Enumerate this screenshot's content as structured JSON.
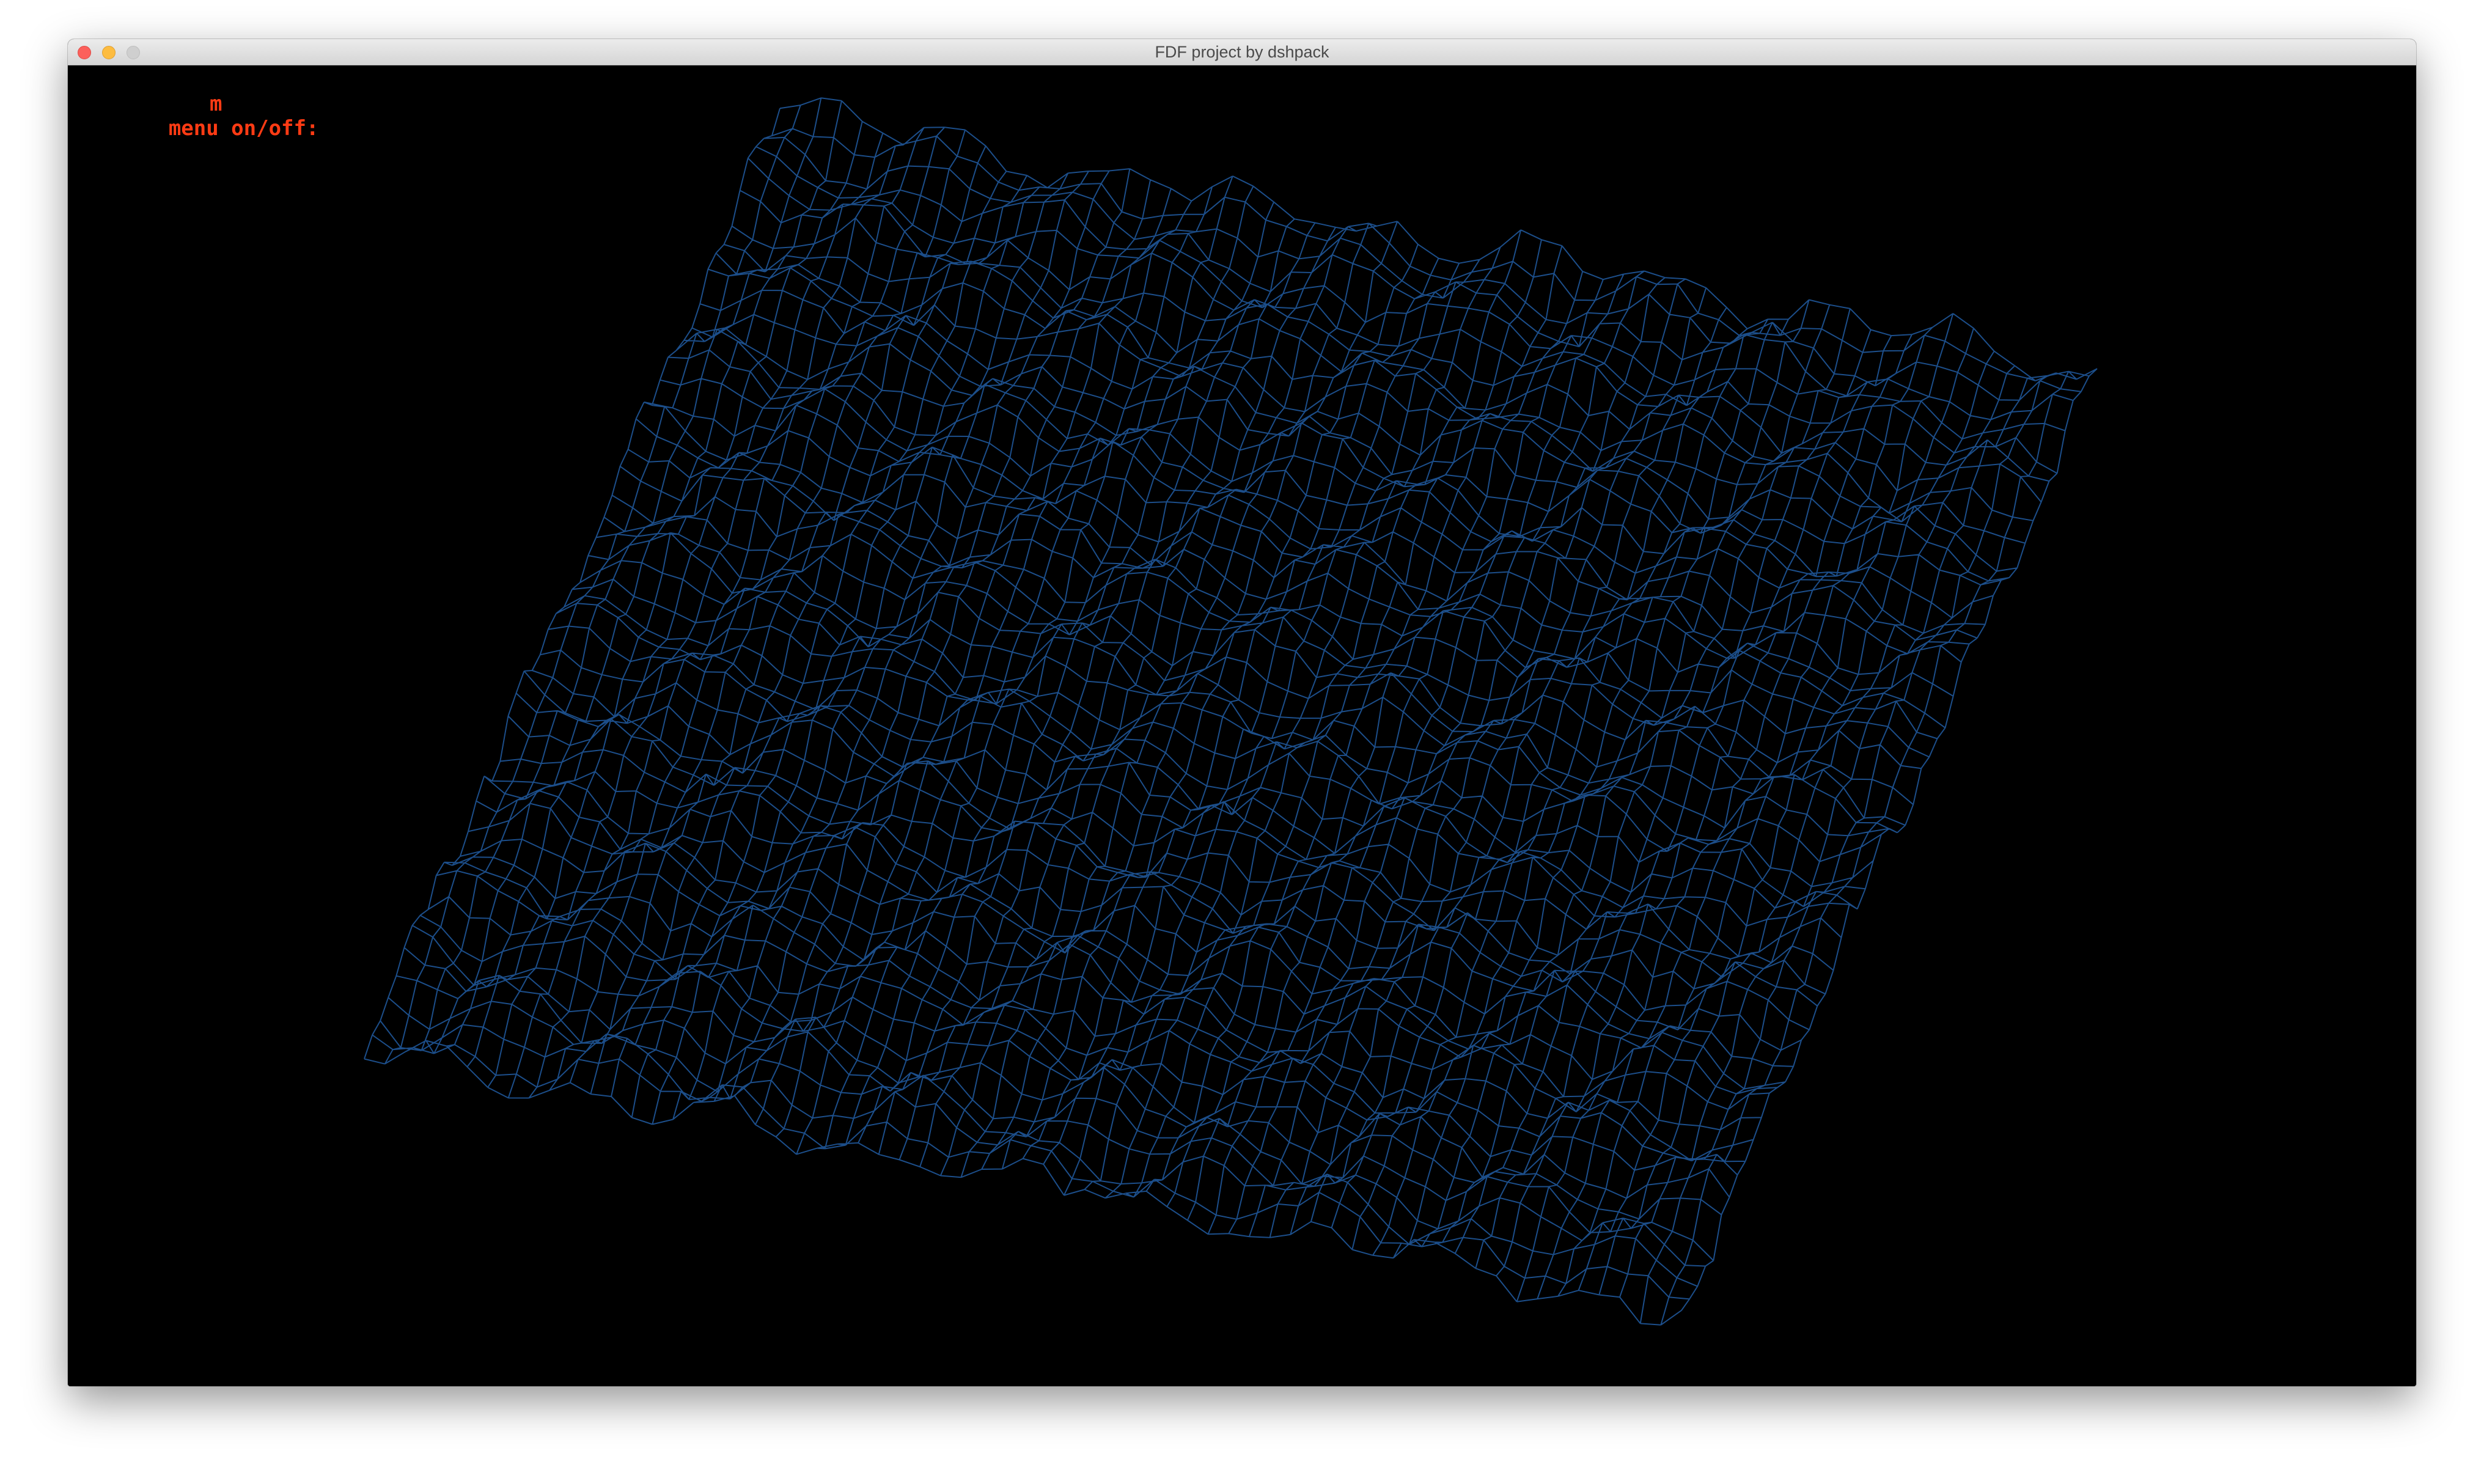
{
  "window": {
    "title": "FDF project by dshpack"
  },
  "menu": {
    "label": "menu on/off:",
    "key": "m"
  },
  "colors": {
    "background": "#000000",
    "wire": "#1c4e8a",
    "menu_text": "#ff3b14"
  }
}
